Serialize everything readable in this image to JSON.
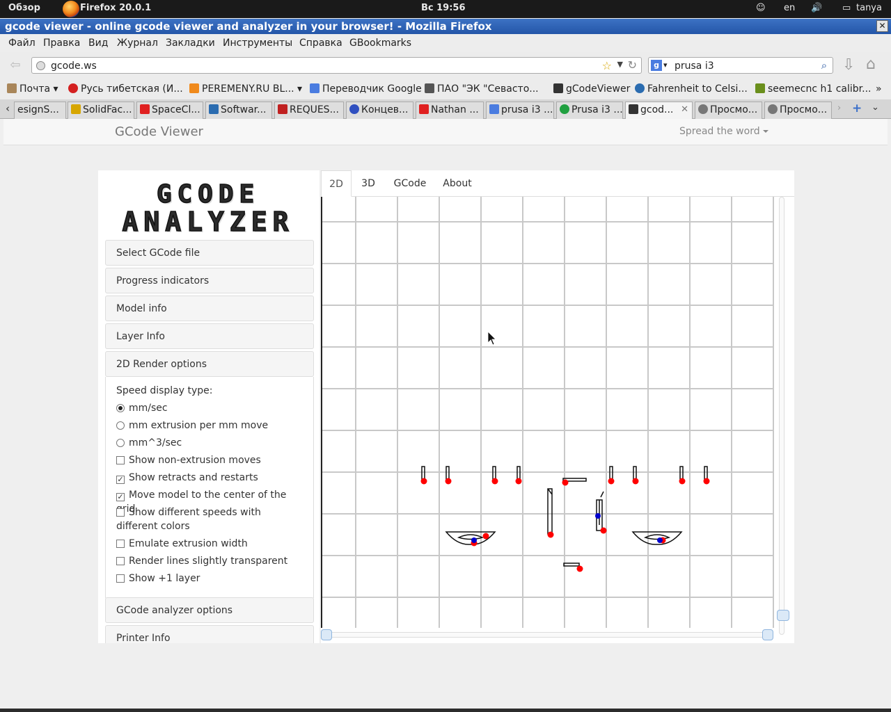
{
  "panel": {
    "overview": "Обзор",
    "app": "Firefox 20.0.1",
    "clock": "Вс 19:56",
    "lang": "en",
    "user": "tanya"
  },
  "window": {
    "title": "gcode viewer - online gcode viewer and analyzer in your browser! - Mozilla Firefox",
    "close": "✕"
  },
  "menu": [
    "Файл",
    "Правка",
    "Вид",
    "Журнал",
    "Закладки",
    "Инструменты",
    "Справка",
    "GBookmarks"
  ],
  "nav": {
    "url": "gcode.ws",
    "search": "prusa i3"
  },
  "bookmarks": [
    {
      "label": "Почта",
      "color": "#a9865a"
    },
    {
      "label": "Русь тибетская (И...",
      "color": "#d42020"
    },
    {
      "label": "PEREMENY.RU BL...",
      "color": "#f08a1c"
    },
    {
      "label": "Переводчик Google",
      "color": "#4a7ce0"
    },
    {
      "label": "ПАО \"ЭК \"Севасто...",
      "color": "#555555"
    },
    {
      "label": "gCodeViewer",
      "color": "#333333"
    },
    {
      "label": "Fahrenheit to Celsi...",
      "color": "#2b6cb0"
    },
    {
      "label": "seemecnc h1 calibr...",
      "color": "#6a8f1c"
    }
  ],
  "tabs": [
    {
      "label": "esignS...",
      "color": "#cccccc"
    },
    {
      "label": "SolidFac...",
      "color": "#d7a600"
    },
    {
      "label": "SpaceCl...",
      "color": "#e02020"
    },
    {
      "label": "Softwar...",
      "color": "#2b6cb0"
    },
    {
      "label": "REQUES...",
      "color": "#c02020"
    },
    {
      "label": "Концев...",
      "color": "#3050c0"
    },
    {
      "label": "Nathan ...",
      "color": "#e02020"
    },
    {
      "label": "prusa i3 ...",
      "color": "#4a7ce0"
    },
    {
      "label": "Prusa i3 ...",
      "color": "#20a040"
    },
    {
      "label": "gcod...",
      "color": "#333333"
    },
    {
      "label": "Просмо...",
      "color": "#777777"
    },
    {
      "label": "Просмо...",
      "color": "#777777"
    }
  ],
  "site": {
    "brand": "GCode Viewer",
    "spread": "Spread the word"
  },
  "logo": {
    "line1": "GCODE",
    "line2": "ANALYZER"
  },
  "accordion": {
    "select_file": "Select GCode file",
    "progress": "Progress indicators",
    "model_info": "Model info",
    "layer_info": "Layer Info",
    "render_options": "2D Render options",
    "analyzer_options": "GCode analyzer options",
    "printer_info": "Printer Info"
  },
  "render_options": {
    "speed_label": "Speed display type:",
    "radios": [
      {
        "label": "mm/sec",
        "checked": true
      },
      {
        "label": "mm extrusion per mm move",
        "checked": false
      },
      {
        "label": "mm^3/sec",
        "checked": false
      }
    ],
    "checks": [
      {
        "label": "Show non-extrusion moves",
        "checked": false
      },
      {
        "label": "Show retracts and restarts",
        "checked": true
      },
      {
        "label": "Move model to the center of the grid",
        "checked": true
      },
      {
        "label": "Show different speeds with different colors",
        "checked": false
      },
      {
        "label": "Emulate extrusion width",
        "checked": false
      },
      {
        "label": "Render lines slightly transparent",
        "checked": false
      },
      {
        "label": "Show +1 layer",
        "checked": false
      }
    ]
  },
  "viewer_tabs": [
    "2D",
    "3D",
    "GCode",
    "About"
  ],
  "colors": {
    "grid": "#c8c8c8",
    "retract": "#ff0000",
    "restart": "#0000cc",
    "accent": "#2456a8"
  }
}
